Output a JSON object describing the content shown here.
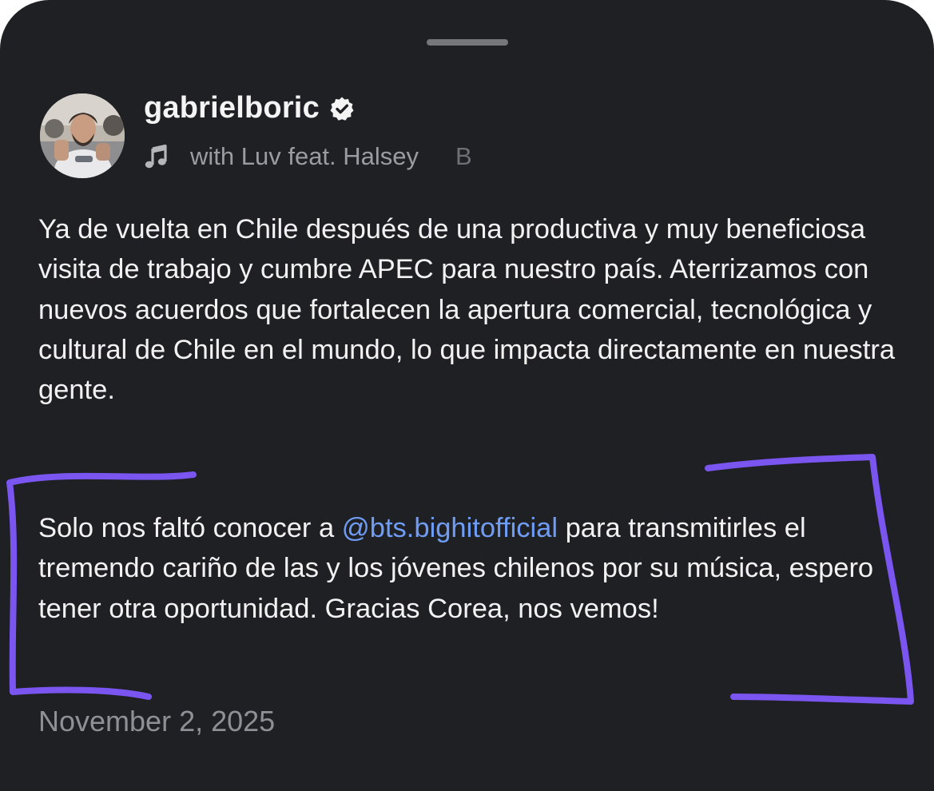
{
  "post": {
    "username": "gabrielboric",
    "verified_icon": "verified-check-icon",
    "music": {
      "icon": "music-note-icon",
      "song": "with Luv feat. Halsey",
      "next_artist": "B"
    },
    "caption": {
      "paragraph_1": "Ya de vuelta en Chile después de una productiva y muy beneficiosa visita de trabajo y cumbre APEC para nuestro país. Aterrizamos con nuevos acuerdos que fortalecen la apertura comercial, tecnológica y cultural de Chile en el mundo, lo que impacta directamente en nuestra gente.",
      "paragraph_2_before": "Solo nos faltó conocer a ",
      "mention": "@bts.bighitofficial",
      "paragraph_2_after": " para transmitirles el tremendo cariño de las y los jóvenes chilenos por su música, espero tener otra oportunidad. Gracias Corea, nos vemos!"
    },
    "date": "November 2, 2025"
  },
  "colors": {
    "background": "#1f2023",
    "text": "#f2f2f3",
    "mention": "#6f9cf5",
    "annotation": "#7b55f0"
  }
}
